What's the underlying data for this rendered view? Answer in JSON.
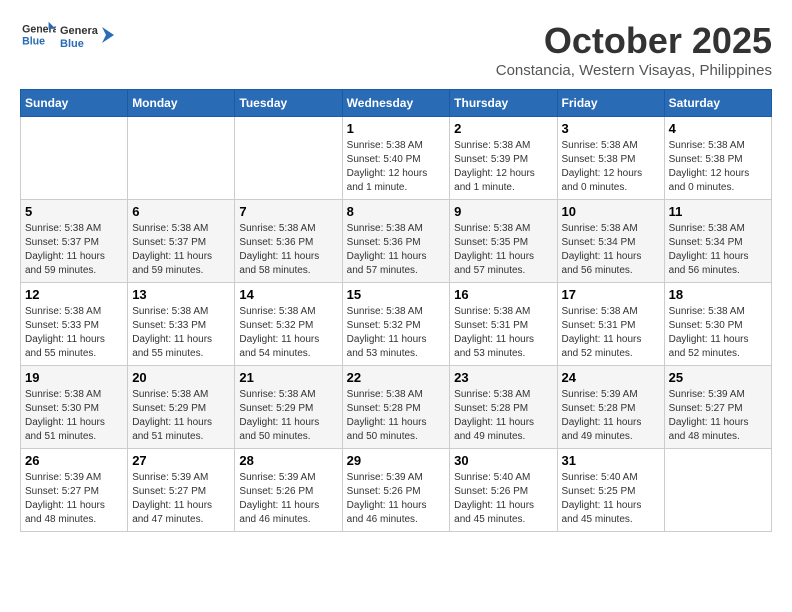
{
  "logo": {
    "text_general": "General",
    "text_blue": "Blue"
  },
  "header": {
    "month": "October 2025",
    "location": "Constancia, Western Visayas, Philippines"
  },
  "weekdays": [
    "Sunday",
    "Monday",
    "Tuesday",
    "Wednesday",
    "Thursday",
    "Friday",
    "Saturday"
  ],
  "weeks": [
    [
      {
        "day": "",
        "info": ""
      },
      {
        "day": "",
        "info": ""
      },
      {
        "day": "",
        "info": ""
      },
      {
        "day": "1",
        "info": "Sunrise: 5:38 AM\nSunset: 5:40 PM\nDaylight: 12 hours\nand 1 minute."
      },
      {
        "day": "2",
        "info": "Sunrise: 5:38 AM\nSunset: 5:39 PM\nDaylight: 12 hours\nand 1 minute."
      },
      {
        "day": "3",
        "info": "Sunrise: 5:38 AM\nSunset: 5:38 PM\nDaylight: 12 hours\nand 0 minutes."
      },
      {
        "day": "4",
        "info": "Sunrise: 5:38 AM\nSunset: 5:38 PM\nDaylight: 12 hours\nand 0 minutes."
      }
    ],
    [
      {
        "day": "5",
        "info": "Sunrise: 5:38 AM\nSunset: 5:37 PM\nDaylight: 11 hours\nand 59 minutes."
      },
      {
        "day": "6",
        "info": "Sunrise: 5:38 AM\nSunset: 5:37 PM\nDaylight: 11 hours\nand 59 minutes."
      },
      {
        "day": "7",
        "info": "Sunrise: 5:38 AM\nSunset: 5:36 PM\nDaylight: 11 hours\nand 58 minutes."
      },
      {
        "day": "8",
        "info": "Sunrise: 5:38 AM\nSunset: 5:36 PM\nDaylight: 11 hours\nand 57 minutes."
      },
      {
        "day": "9",
        "info": "Sunrise: 5:38 AM\nSunset: 5:35 PM\nDaylight: 11 hours\nand 57 minutes."
      },
      {
        "day": "10",
        "info": "Sunrise: 5:38 AM\nSunset: 5:34 PM\nDaylight: 11 hours\nand 56 minutes."
      },
      {
        "day": "11",
        "info": "Sunrise: 5:38 AM\nSunset: 5:34 PM\nDaylight: 11 hours\nand 56 minutes."
      }
    ],
    [
      {
        "day": "12",
        "info": "Sunrise: 5:38 AM\nSunset: 5:33 PM\nDaylight: 11 hours\nand 55 minutes."
      },
      {
        "day": "13",
        "info": "Sunrise: 5:38 AM\nSunset: 5:33 PM\nDaylight: 11 hours\nand 55 minutes."
      },
      {
        "day": "14",
        "info": "Sunrise: 5:38 AM\nSunset: 5:32 PM\nDaylight: 11 hours\nand 54 minutes."
      },
      {
        "day": "15",
        "info": "Sunrise: 5:38 AM\nSunset: 5:32 PM\nDaylight: 11 hours\nand 53 minutes."
      },
      {
        "day": "16",
        "info": "Sunrise: 5:38 AM\nSunset: 5:31 PM\nDaylight: 11 hours\nand 53 minutes."
      },
      {
        "day": "17",
        "info": "Sunrise: 5:38 AM\nSunset: 5:31 PM\nDaylight: 11 hours\nand 52 minutes."
      },
      {
        "day": "18",
        "info": "Sunrise: 5:38 AM\nSunset: 5:30 PM\nDaylight: 11 hours\nand 52 minutes."
      }
    ],
    [
      {
        "day": "19",
        "info": "Sunrise: 5:38 AM\nSunset: 5:30 PM\nDaylight: 11 hours\nand 51 minutes."
      },
      {
        "day": "20",
        "info": "Sunrise: 5:38 AM\nSunset: 5:29 PM\nDaylight: 11 hours\nand 51 minutes."
      },
      {
        "day": "21",
        "info": "Sunrise: 5:38 AM\nSunset: 5:29 PM\nDaylight: 11 hours\nand 50 minutes."
      },
      {
        "day": "22",
        "info": "Sunrise: 5:38 AM\nSunset: 5:28 PM\nDaylight: 11 hours\nand 50 minutes."
      },
      {
        "day": "23",
        "info": "Sunrise: 5:38 AM\nSunset: 5:28 PM\nDaylight: 11 hours\nand 49 minutes."
      },
      {
        "day": "24",
        "info": "Sunrise: 5:39 AM\nSunset: 5:28 PM\nDaylight: 11 hours\nand 49 minutes."
      },
      {
        "day": "25",
        "info": "Sunrise: 5:39 AM\nSunset: 5:27 PM\nDaylight: 11 hours\nand 48 minutes."
      }
    ],
    [
      {
        "day": "26",
        "info": "Sunrise: 5:39 AM\nSunset: 5:27 PM\nDaylight: 11 hours\nand 48 minutes."
      },
      {
        "day": "27",
        "info": "Sunrise: 5:39 AM\nSunset: 5:27 PM\nDaylight: 11 hours\nand 47 minutes."
      },
      {
        "day": "28",
        "info": "Sunrise: 5:39 AM\nSunset: 5:26 PM\nDaylight: 11 hours\nand 46 minutes."
      },
      {
        "day": "29",
        "info": "Sunrise: 5:39 AM\nSunset: 5:26 PM\nDaylight: 11 hours\nand 46 minutes."
      },
      {
        "day": "30",
        "info": "Sunrise: 5:40 AM\nSunset: 5:26 PM\nDaylight: 11 hours\nand 45 minutes."
      },
      {
        "day": "31",
        "info": "Sunrise: 5:40 AM\nSunset: 5:25 PM\nDaylight: 11 hours\nand 45 minutes."
      },
      {
        "day": "",
        "info": ""
      }
    ]
  ]
}
